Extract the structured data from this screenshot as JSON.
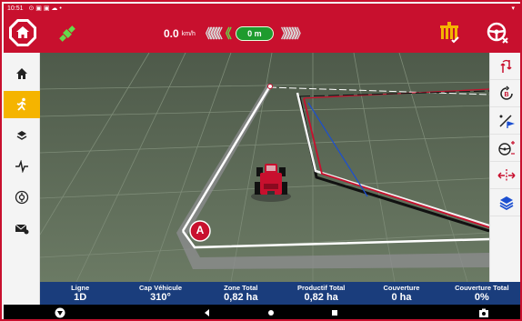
{
  "status_bar": {
    "time": "10:51"
  },
  "top_bar": {
    "speed_value": "0.0",
    "speed_unit": "km/h",
    "guidance_offset": "0 m"
  },
  "left_nav": [
    {
      "name": "home",
      "icon": "home-icon",
      "active": false
    },
    {
      "name": "guidance",
      "icon": "runner-icon",
      "active": true
    },
    {
      "name": "field",
      "icon": "layers-icon",
      "active": false
    },
    {
      "name": "diagnostics",
      "icon": "pulse-icon",
      "active": false
    },
    {
      "name": "settings",
      "icon": "circle-settings-icon",
      "active": false
    },
    {
      "name": "messages",
      "icon": "mail-icon",
      "active": false
    }
  ],
  "right_tools": [
    {
      "name": "guidance-lines",
      "icon": "ab-line-icon"
    },
    {
      "name": "recenter",
      "icon": "rotate-b-icon"
    },
    {
      "name": "boundary",
      "icon": "flag-line-icon"
    },
    {
      "name": "steering-adjust",
      "icon": "steering-plus-minus-icon"
    },
    {
      "name": "shift-line",
      "icon": "shift-arrows-icon"
    },
    {
      "name": "map-layers",
      "icon": "stack-layers-icon"
    }
  ],
  "map": {
    "point_label": "A"
  },
  "info_bar": [
    {
      "label": "Ligne",
      "value": "1D"
    },
    {
      "label": "Cap Véhicule",
      "value": "310°"
    },
    {
      "label": "Zone Total",
      "value": "0,82 ha"
    },
    {
      "label": "Productif Total",
      "value": "0,82 ha"
    },
    {
      "label": "Couverture",
      "value": "0 ha"
    },
    {
      "label": "Couverture Total",
      "value": "0%"
    }
  ],
  "colors": {
    "brand_red": "#c8102e",
    "info_blue": "#1a3d7c",
    "active_yellow": "#f5b400",
    "offset_green": "#1e9b2e"
  }
}
